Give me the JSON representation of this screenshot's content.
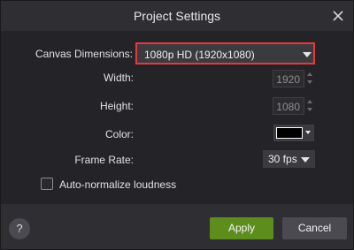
{
  "dialog": {
    "title": "Project Settings",
    "close_icon": "close-icon"
  },
  "fields": {
    "canvas_dimensions": {
      "label": "Canvas Dimensions:",
      "value": "1080p HD (1920x1080)"
    },
    "width": {
      "label": "Width:",
      "value": "1920"
    },
    "height": {
      "label": "Height:",
      "value": "1080"
    },
    "color": {
      "label": "Color:",
      "value": "#000000"
    },
    "frame_rate": {
      "label": "Frame Rate:",
      "value": "30 fps"
    }
  },
  "options": {
    "auto_normalize": {
      "label": "Auto-normalize loudness",
      "checked": false
    }
  },
  "footer": {
    "help_label": "?",
    "apply_label": "Apply",
    "cancel_label": "Cancel"
  },
  "colors": {
    "accent_highlight": "#e8383d",
    "apply_button": "#5c8d1d"
  }
}
